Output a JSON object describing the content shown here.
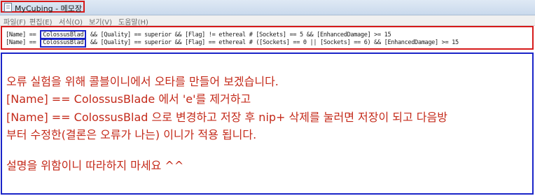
{
  "window": {
    "title": "MyCubing - 메모장",
    "icon": "notepad-icon"
  },
  "menu": [
    "파일(F)",
    "편집(E)",
    "서식(O)",
    "보기(V)",
    "도움말(H)"
  ],
  "code": {
    "line1": {
      "prefix": "[Name] ==",
      "highlight": "ColossusBlad",
      "suffix": "&& [Quality] == superior && [Flag] != ethereal # [Sockets] == 5 && [EnhancedDamage] >= 15"
    },
    "line2": {
      "prefix": "[Name] ==",
      "highlight": "ColossusBlad",
      "suffix": "&& [Quality] == superior && [Flag] == ethereal # ([Sockets] == 0 || [Sockets] == 6) && [EnhancedDamage] >= 15"
    }
  },
  "message": {
    "line1": "오류 실험을 위해 콜블이니에서 오타를 만들어 보겠습니다.",
    "line2": "[Name] == ColossusBlade 에서 'e'를 제거하고",
    "line3": "[Name] == ColossusBlad 으로 변경하고 저장 후 nip+ 삭제를 눌러면 저장이 되고 다음방",
    "line4": "부터 수정한(결론은 오류가 나는) 이니가 적용 됩니다.",
    "line5": "설명을 위함이니 따라하지 마세요 ^^"
  },
  "colors": {
    "annotation_red": "#d61a1a",
    "annotation_blue": "#1a24c8",
    "message_text": "#c42a1a"
  }
}
